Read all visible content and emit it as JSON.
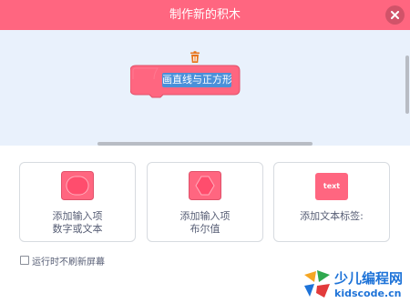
{
  "dialog": {
    "title": "制作新的积木",
    "close_icon": "close-icon"
  },
  "editor": {
    "block_name": "画直线与正方形",
    "trash_icon": "trash-icon"
  },
  "options": [
    {
      "line1": "添加输入项",
      "line2": "数字或文本",
      "icon": "round-input-icon"
    },
    {
      "line1": "添加输入项",
      "line2": "布尔值",
      "icon": "diamond-input-icon"
    },
    {
      "line1": "添加文本标签:",
      "chip": "text",
      "icon": "text-label-icon"
    }
  ],
  "checkbox": {
    "label": "运行时不刷新屏幕",
    "checked": false
  },
  "watermark": {
    "cn": "少儿编程网",
    "url": "kidscode.cn"
  },
  "colors": {
    "accent": "#ff6680",
    "canvas_bg": "#e9f1fc",
    "selection": "#4a90d9",
    "text": "#575e75"
  }
}
